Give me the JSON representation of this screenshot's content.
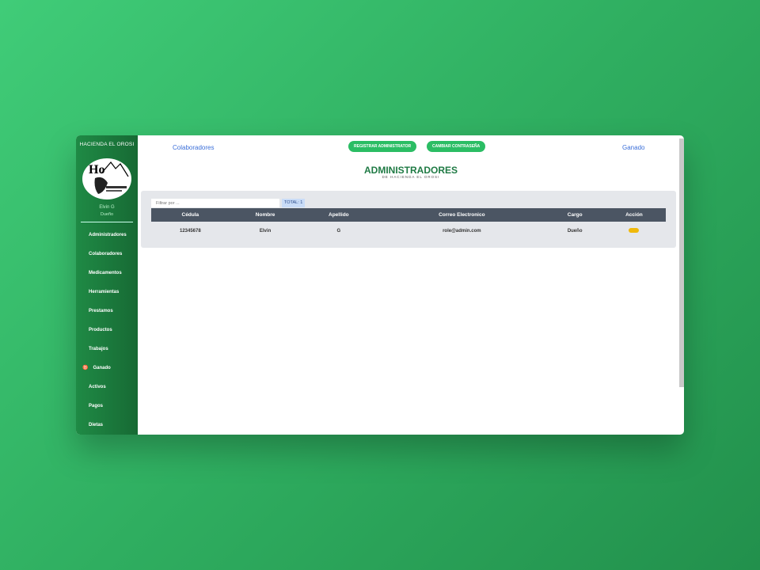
{
  "sidebar": {
    "brand": "HACIENDA EL OROSI",
    "user_name": "Elvin G",
    "user_role": "Dueño",
    "items": [
      {
        "label": "Administradores"
      },
      {
        "label": "Colaboradores"
      },
      {
        "label": "Medicamentos"
      },
      {
        "label": "Herramientas"
      },
      {
        "label": "Prestamos"
      },
      {
        "label": "Productos"
      },
      {
        "label": "Trabajos"
      },
      {
        "label": "Ganado",
        "icon": "bull-icon"
      },
      {
        "label": "Activos"
      },
      {
        "label": "Pagos"
      },
      {
        "label": "Dietas"
      }
    ]
  },
  "header": {
    "left_link": "Colaboradores",
    "right_link": "Ganado",
    "btn_register": "REGISTRAR ADMINISTRATOR",
    "btn_password": "CAMBIAR CONTRASEÑA"
  },
  "page": {
    "title": "ADMINISTRADORES",
    "subtitle": "DE HACIENDA EL OROSI"
  },
  "filter": {
    "placeholder": "Filtrar por ...",
    "total": "TOTAL: 1"
  },
  "table": {
    "headers": [
      "Cédula",
      "Nombre",
      "Apellido",
      "Correo Electronico",
      "Cargo",
      "Acción"
    ],
    "rows": [
      [
        "12345678",
        "Elvin",
        "G",
        "role@admin.com",
        "Dueño"
      ]
    ]
  },
  "colors": {
    "accent": "#2bbd64",
    "sidebar": "#1f8a45",
    "action": "#f0b90b"
  }
}
